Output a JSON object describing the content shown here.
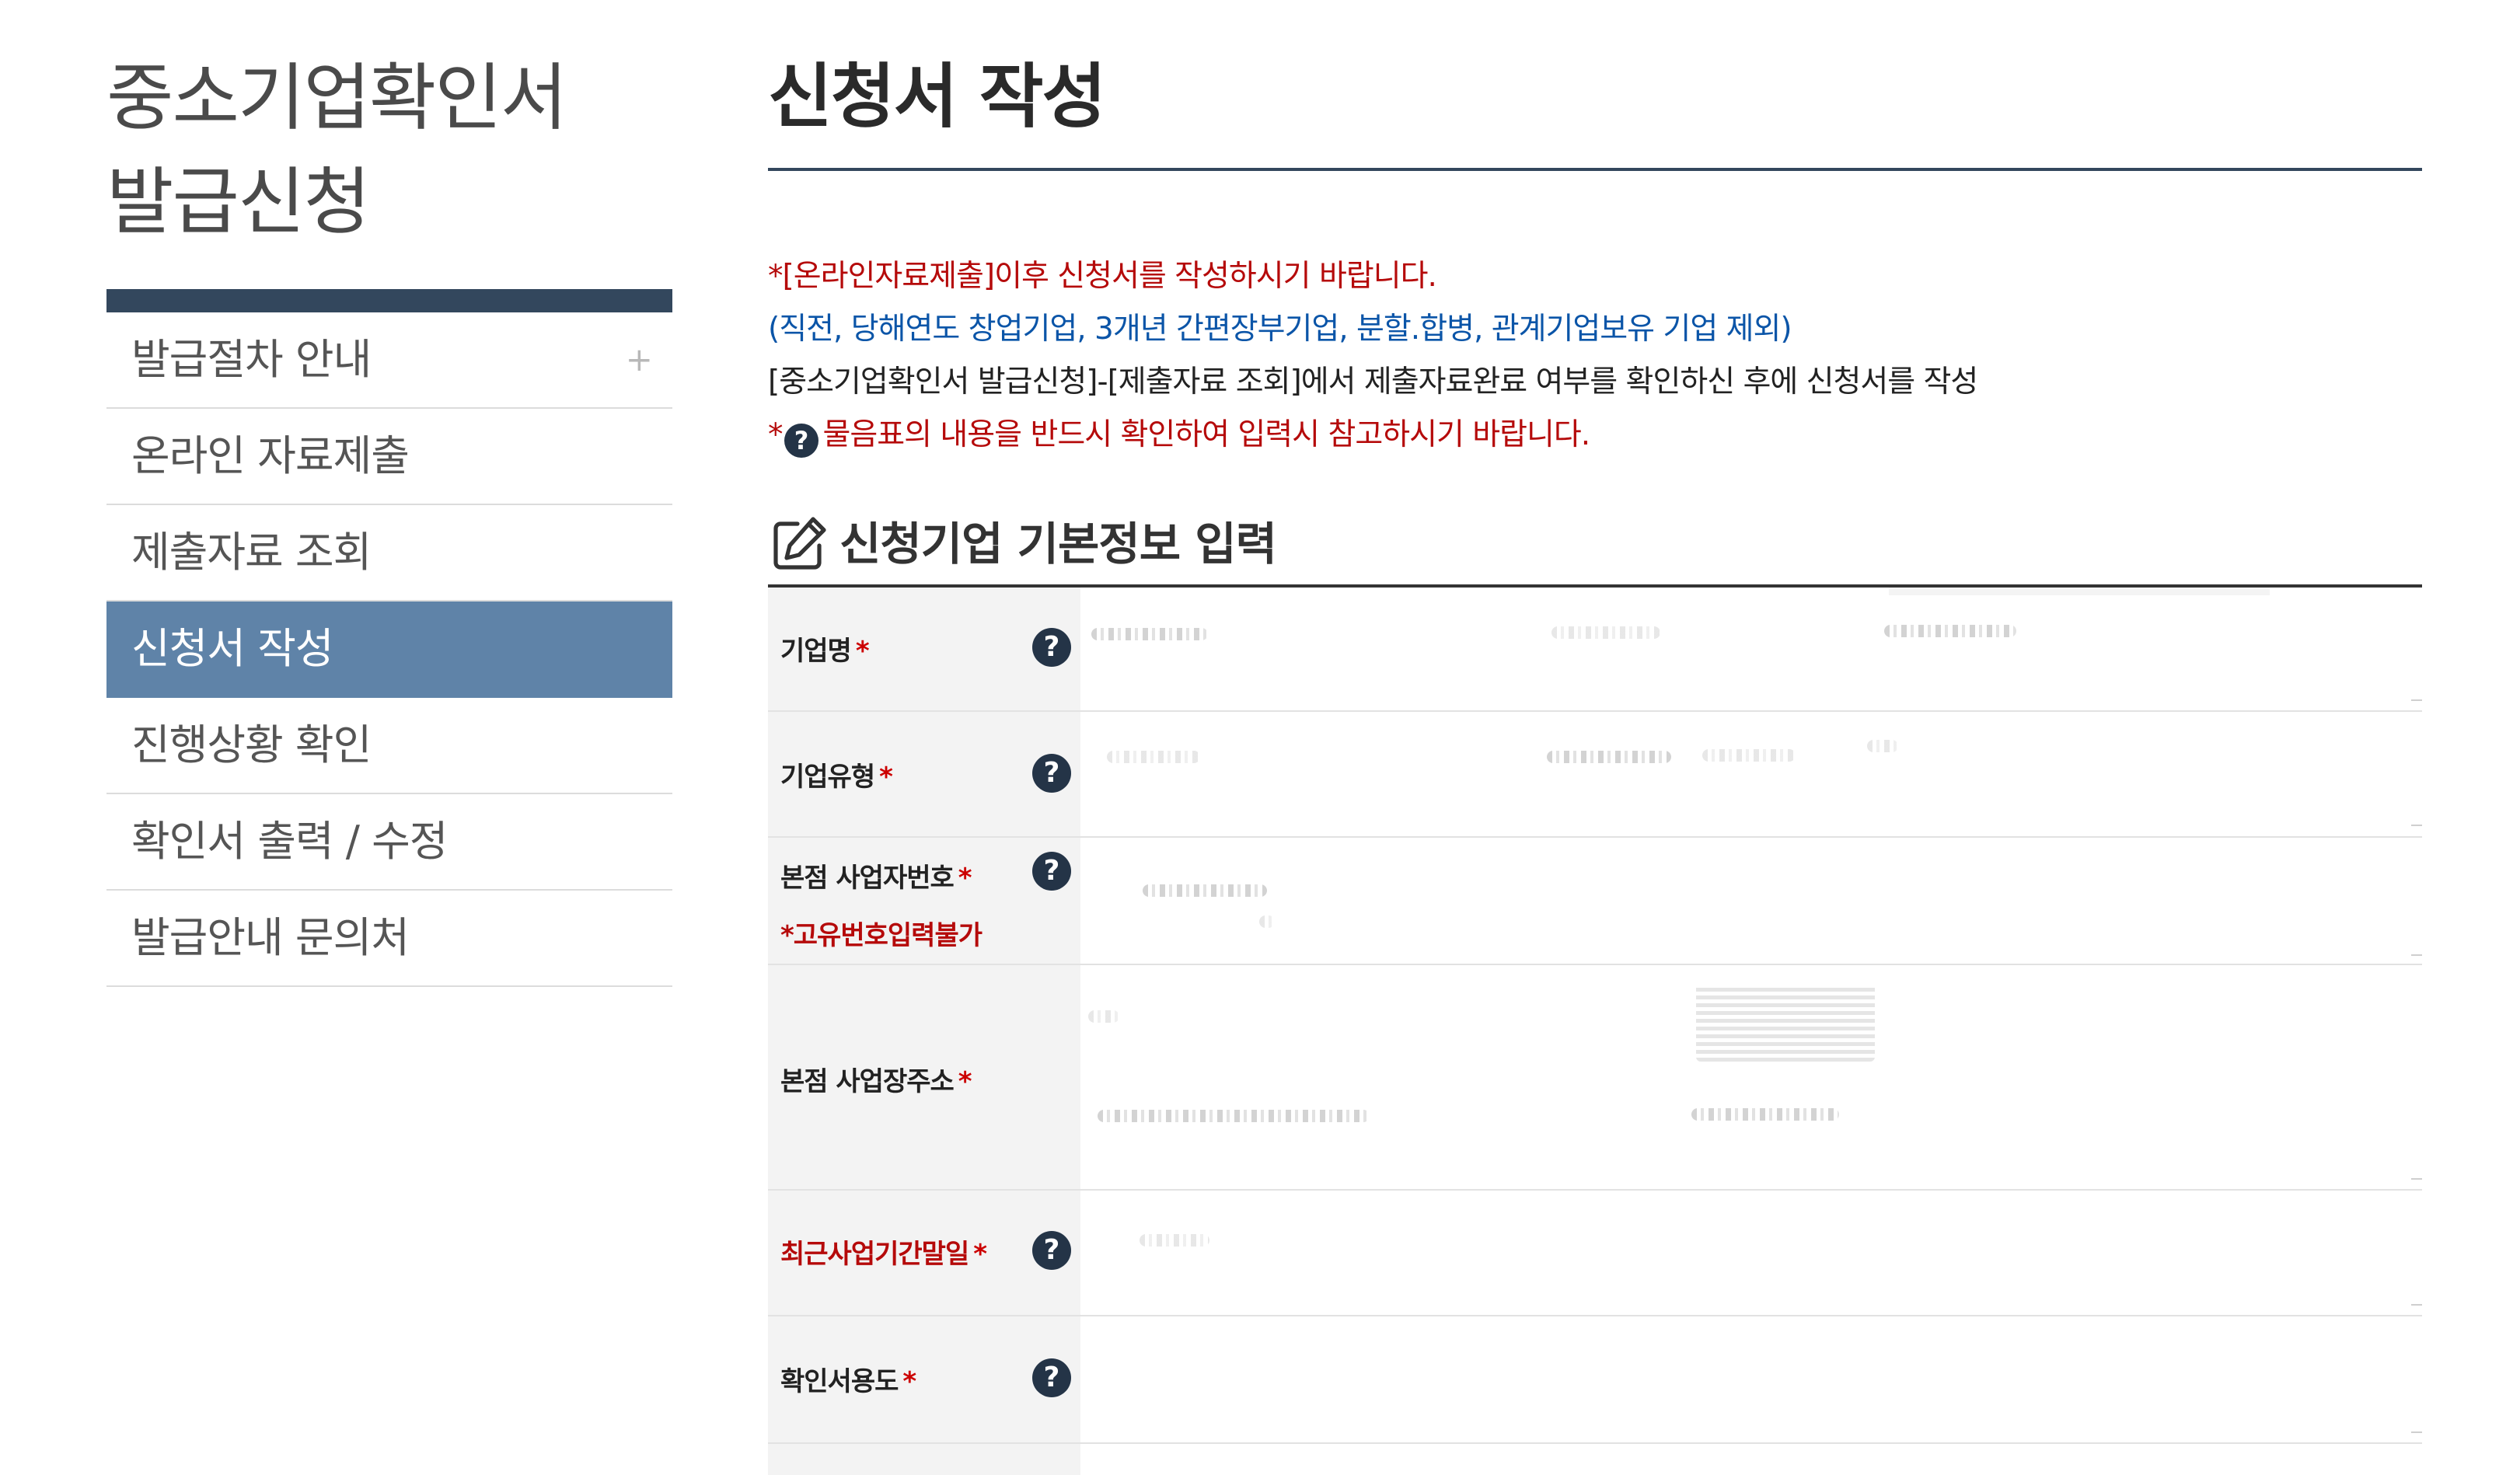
{
  "sidebar": {
    "title_line1": "중소기업확인서",
    "title_line2": "발급신청",
    "items": [
      {
        "label": "발급절차 안내",
        "has_plus": true,
        "active": false
      },
      {
        "label": "온라인 자료제출",
        "active": false
      },
      {
        "label": "제출자료 조회",
        "active": false
      },
      {
        "label": "신청서 작성",
        "active": true
      },
      {
        "label": "진행상황 확인",
        "active": false
      },
      {
        "label": "확인서 출력 / 수정",
        "active": false
      },
      {
        "label": "발급안내 문의처",
        "active": false
      }
    ],
    "plus_symbol": "+"
  },
  "main": {
    "title": "신청서 작성",
    "notices": {
      "line1": "*[온라인자료제출]이후 신청서를 작성하시기 바랍니다.",
      "line2": "(직전, 당해연도 창업기업, 3개년 간편장부기업, 분할.합병, 관계기업보유 기업 제외)",
      "line3": "[중소기업확인서 발급신청]-[제출자료 조회]에서 제출자료완료 여부를 확인하신 후에 신청서를 작성",
      "line4_prefix": "*",
      "line4_icon": "?",
      "line4_text": "물음표의 내용을 반드시 확인하여 입력시 참고하시기 바랍니다."
    },
    "section_title": "신청기업 기본정보 입력",
    "form_rows": [
      {
        "label": "기업명",
        "required": "*",
        "help": "?"
      },
      {
        "label": "기업유형",
        "required": "*",
        "help": "?"
      },
      {
        "label": "본점 사업자번호",
        "required": "*",
        "help": "?",
        "sublabel": "*고유번호입력불가"
      },
      {
        "label": "본점 사업장주소",
        "required": "*"
      },
      {
        "label": "최근사업기간말일",
        "required": "*",
        "help": "?",
        "label_red": true
      },
      {
        "label": "확인서용도",
        "required": "*",
        "help": "?"
      }
    ]
  },
  "colors": {
    "sidebar_bar": "#33475d",
    "sidebar_active": "#5f83a8",
    "notice_red": "#b50a0a",
    "notice_blue": "#0b55a8",
    "help_icon": "#243447"
  }
}
